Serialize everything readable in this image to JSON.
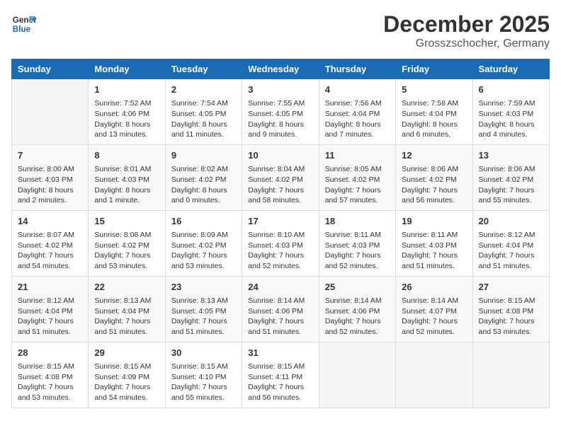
{
  "header": {
    "logo_line1": "General",
    "logo_line2": "Blue",
    "month": "December 2025",
    "location": "Grosszschocher, Germany"
  },
  "days_of_week": [
    "Sunday",
    "Monday",
    "Tuesday",
    "Wednesday",
    "Thursday",
    "Friday",
    "Saturday"
  ],
  "weeks": [
    [
      {
        "day": "",
        "sunrise": "",
        "sunset": "",
        "daylight": ""
      },
      {
        "day": "1",
        "sunrise": "Sunrise: 7:52 AM",
        "sunset": "Sunset: 4:06 PM",
        "daylight": "Daylight: 8 hours and 13 minutes."
      },
      {
        "day": "2",
        "sunrise": "Sunrise: 7:54 AM",
        "sunset": "Sunset: 4:05 PM",
        "daylight": "Daylight: 8 hours and 11 minutes."
      },
      {
        "day": "3",
        "sunrise": "Sunrise: 7:55 AM",
        "sunset": "Sunset: 4:05 PM",
        "daylight": "Daylight: 8 hours and 9 minutes."
      },
      {
        "day": "4",
        "sunrise": "Sunrise: 7:56 AM",
        "sunset": "Sunset: 4:04 PM",
        "daylight": "Daylight: 8 hours and 7 minutes."
      },
      {
        "day": "5",
        "sunrise": "Sunrise: 7:58 AM",
        "sunset": "Sunset: 4:04 PM",
        "daylight": "Daylight: 8 hours and 6 minutes."
      },
      {
        "day": "6",
        "sunrise": "Sunrise: 7:59 AM",
        "sunset": "Sunset: 4:03 PM",
        "daylight": "Daylight: 8 hours and 4 minutes."
      }
    ],
    [
      {
        "day": "7",
        "sunrise": "Sunrise: 8:00 AM",
        "sunset": "Sunset: 4:03 PM",
        "daylight": "Daylight: 8 hours and 2 minutes."
      },
      {
        "day": "8",
        "sunrise": "Sunrise: 8:01 AM",
        "sunset": "Sunset: 4:03 PM",
        "daylight": "Daylight: 8 hours and 1 minute."
      },
      {
        "day": "9",
        "sunrise": "Sunrise: 8:02 AM",
        "sunset": "Sunset: 4:02 PM",
        "daylight": "Daylight: 8 hours and 0 minutes."
      },
      {
        "day": "10",
        "sunrise": "Sunrise: 8:04 AM",
        "sunset": "Sunset: 4:02 PM",
        "daylight": "Daylight: 7 hours and 58 minutes."
      },
      {
        "day": "11",
        "sunrise": "Sunrise: 8:05 AM",
        "sunset": "Sunset: 4:02 PM",
        "daylight": "Daylight: 7 hours and 57 minutes."
      },
      {
        "day": "12",
        "sunrise": "Sunrise: 8:06 AM",
        "sunset": "Sunset: 4:02 PM",
        "daylight": "Daylight: 7 hours and 56 minutes."
      },
      {
        "day": "13",
        "sunrise": "Sunrise: 8:06 AM",
        "sunset": "Sunset: 4:02 PM",
        "daylight": "Daylight: 7 hours and 55 minutes."
      }
    ],
    [
      {
        "day": "14",
        "sunrise": "Sunrise: 8:07 AM",
        "sunset": "Sunset: 4:02 PM",
        "daylight": "Daylight: 7 hours and 54 minutes."
      },
      {
        "day": "15",
        "sunrise": "Sunrise: 8:08 AM",
        "sunset": "Sunset: 4:02 PM",
        "daylight": "Daylight: 7 hours and 53 minutes."
      },
      {
        "day": "16",
        "sunrise": "Sunrise: 8:09 AM",
        "sunset": "Sunset: 4:02 PM",
        "daylight": "Daylight: 7 hours and 53 minutes."
      },
      {
        "day": "17",
        "sunrise": "Sunrise: 8:10 AM",
        "sunset": "Sunset: 4:03 PM",
        "daylight": "Daylight: 7 hours and 52 minutes."
      },
      {
        "day": "18",
        "sunrise": "Sunrise: 8:11 AM",
        "sunset": "Sunset: 4:03 PM",
        "daylight": "Daylight: 7 hours and 52 minutes."
      },
      {
        "day": "19",
        "sunrise": "Sunrise: 8:11 AM",
        "sunset": "Sunset: 4:03 PM",
        "daylight": "Daylight: 7 hours and 51 minutes."
      },
      {
        "day": "20",
        "sunrise": "Sunrise: 8:12 AM",
        "sunset": "Sunset: 4:04 PM",
        "daylight": "Daylight: 7 hours and 51 minutes."
      }
    ],
    [
      {
        "day": "21",
        "sunrise": "Sunrise: 8:12 AM",
        "sunset": "Sunset: 4:04 PM",
        "daylight": "Daylight: 7 hours and 51 minutes."
      },
      {
        "day": "22",
        "sunrise": "Sunrise: 8:13 AM",
        "sunset": "Sunset: 4:04 PM",
        "daylight": "Daylight: 7 hours and 51 minutes."
      },
      {
        "day": "23",
        "sunrise": "Sunrise: 8:13 AM",
        "sunset": "Sunset: 4:05 PM",
        "daylight": "Daylight: 7 hours and 51 minutes."
      },
      {
        "day": "24",
        "sunrise": "Sunrise: 8:14 AM",
        "sunset": "Sunset: 4:06 PM",
        "daylight": "Daylight: 7 hours and 51 minutes."
      },
      {
        "day": "25",
        "sunrise": "Sunrise: 8:14 AM",
        "sunset": "Sunset: 4:06 PM",
        "daylight": "Daylight: 7 hours and 52 minutes."
      },
      {
        "day": "26",
        "sunrise": "Sunrise: 8:14 AM",
        "sunset": "Sunset: 4:07 PM",
        "daylight": "Daylight: 7 hours and 52 minutes."
      },
      {
        "day": "27",
        "sunrise": "Sunrise: 8:15 AM",
        "sunset": "Sunset: 4:08 PM",
        "daylight": "Daylight: 7 hours and 53 minutes."
      }
    ],
    [
      {
        "day": "28",
        "sunrise": "Sunrise: 8:15 AM",
        "sunset": "Sunset: 4:08 PM",
        "daylight": "Daylight: 7 hours and 53 minutes."
      },
      {
        "day": "29",
        "sunrise": "Sunrise: 8:15 AM",
        "sunset": "Sunset: 4:09 PM",
        "daylight": "Daylight: 7 hours and 54 minutes."
      },
      {
        "day": "30",
        "sunrise": "Sunrise: 8:15 AM",
        "sunset": "Sunset: 4:10 PM",
        "daylight": "Daylight: 7 hours and 55 minutes."
      },
      {
        "day": "31",
        "sunrise": "Sunrise: 8:15 AM",
        "sunset": "Sunset: 4:11 PM",
        "daylight": "Daylight: 7 hours and 56 minutes."
      },
      {
        "day": "",
        "sunrise": "",
        "sunset": "",
        "daylight": ""
      },
      {
        "day": "",
        "sunrise": "",
        "sunset": "",
        "daylight": ""
      },
      {
        "day": "",
        "sunrise": "",
        "sunset": "",
        "daylight": ""
      }
    ]
  ]
}
